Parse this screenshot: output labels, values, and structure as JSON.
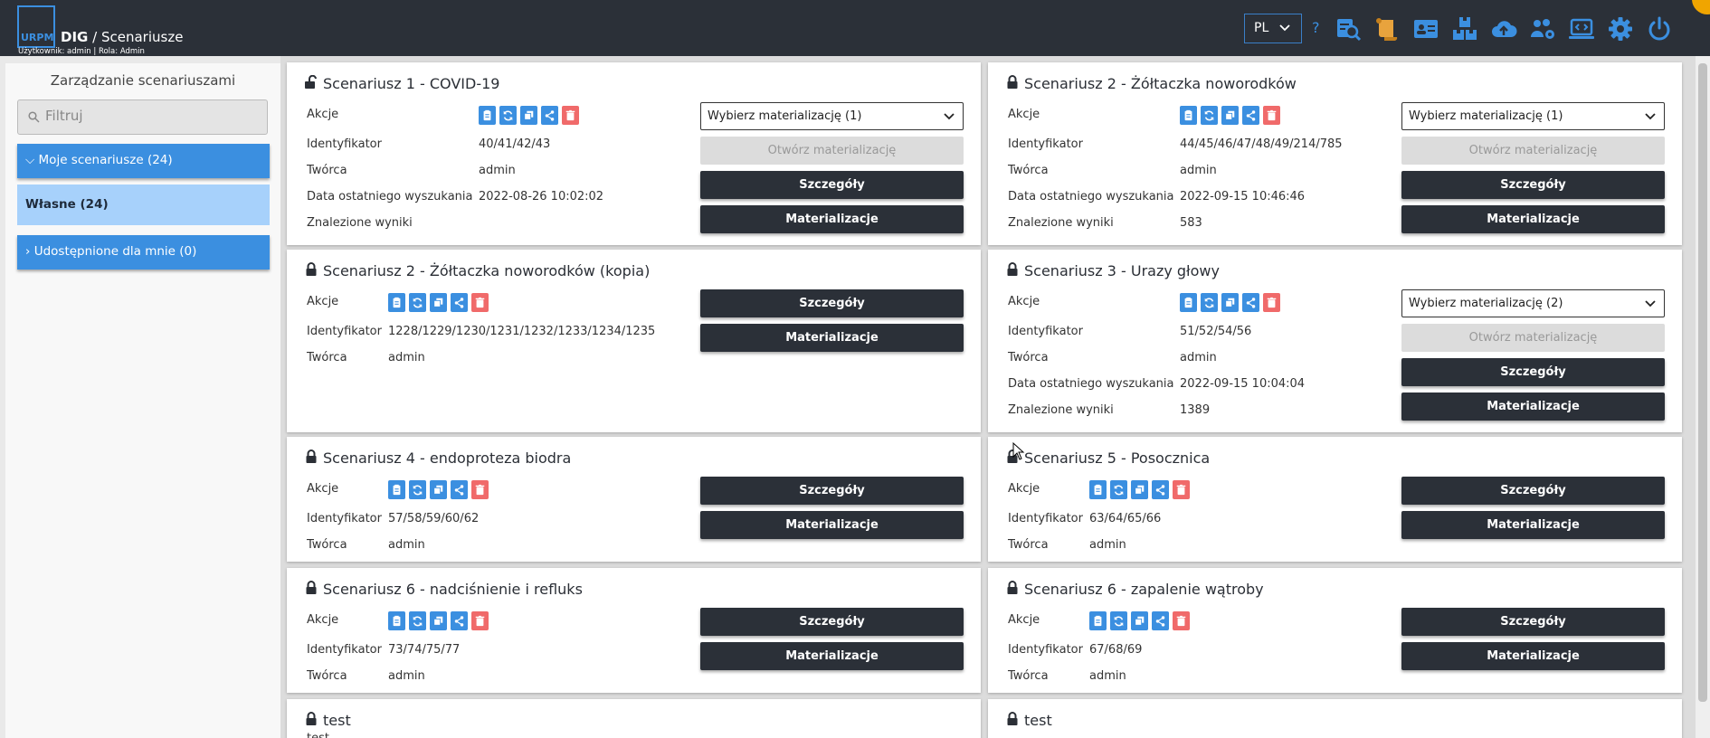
{
  "header": {
    "logo_text": "URPM",
    "app_name": "DIG",
    "separator": "/",
    "page_name": "Scenariusze",
    "user_info": "Użytkownik: admin | Rola: Admin",
    "language": "PL",
    "help": "?"
  },
  "toolbar_icons": [
    "search-report-icon",
    "scroll-icon",
    "user-card-icon",
    "boxes-icon",
    "cloud-upload-icon",
    "users-gear-icon",
    "code-screen-icon",
    "settings-gear-icon",
    "power-icon"
  ],
  "colors": {
    "accent": "#3b8fe0",
    "dark": "#2b3038",
    "danger": "#f06a6a",
    "selected": "#a7d1fb"
  },
  "sidebar": {
    "title": "Zarządzanie scenariuszami",
    "filter_placeholder": "Filtruj",
    "my_scenarios": "Moje scenariusze (24)",
    "own": "Własne (24)",
    "shared": "Udostępnione dla mnie (0)"
  },
  "labels": {
    "actions": "Akcje",
    "identifier": "Identyfikator",
    "creator": "Twórca",
    "last_search": "Data ostatniego wyszukania",
    "results": "Znalezione wyniki",
    "open_materialization": "Otwórz materializację",
    "details": "Szczegóły",
    "materializations": "Materializacje"
  },
  "scenarios": [
    {
      "title": "Scenariusz 1 - COVID-19",
      "lock": "open",
      "identifier": "40/41/42/43",
      "creator": "admin",
      "last_search": "2022-08-26 10:02:02",
      "results": "",
      "select": "Wybierz materializację (1)"
    },
    {
      "title": "Scenariusz 2 - Żółtaczka noworodków",
      "lock": "closed",
      "identifier": "44/45/46/47/48/49/214/785",
      "creator": "admin",
      "last_search": "2022-09-15 10:46:46",
      "results": "583",
      "select": "Wybierz materializację (1)"
    },
    {
      "title": "Scenariusz 2 - Żółtaczka noworodków (kopia)",
      "lock": "closed",
      "identifier": "1228/1229/1230/1231/1232/1233/1234/1235",
      "creator": "admin"
    },
    {
      "title": "Scenariusz 3 - Urazy głowy",
      "lock": "closed",
      "identifier": "51/52/54/56",
      "creator": "admin",
      "last_search": "2022-09-15 10:04:04",
      "results": "1389",
      "select": "Wybierz materializację (2)"
    },
    {
      "title": "Scenariusz 4 - endoproteza biodra",
      "lock": "closed",
      "identifier": "57/58/59/60/62",
      "creator": "admin"
    },
    {
      "title": "Scenariusz 5 - Posocznica",
      "lock": "closed",
      "identifier": "63/64/65/66",
      "creator": "admin"
    },
    {
      "title": "Scenariusz 6 - nadciśnienie i refluks",
      "lock": "closed",
      "identifier": "73/74/75/77",
      "creator": "admin"
    },
    {
      "title": "Scenariusz 6 - zapalenie wątroby",
      "lock": "closed",
      "identifier": "67/68/69",
      "creator": "admin"
    },
    {
      "title": "test",
      "lock": "closed",
      "subtitle": "test"
    },
    {
      "title": "test",
      "lock": "closed"
    }
  ]
}
